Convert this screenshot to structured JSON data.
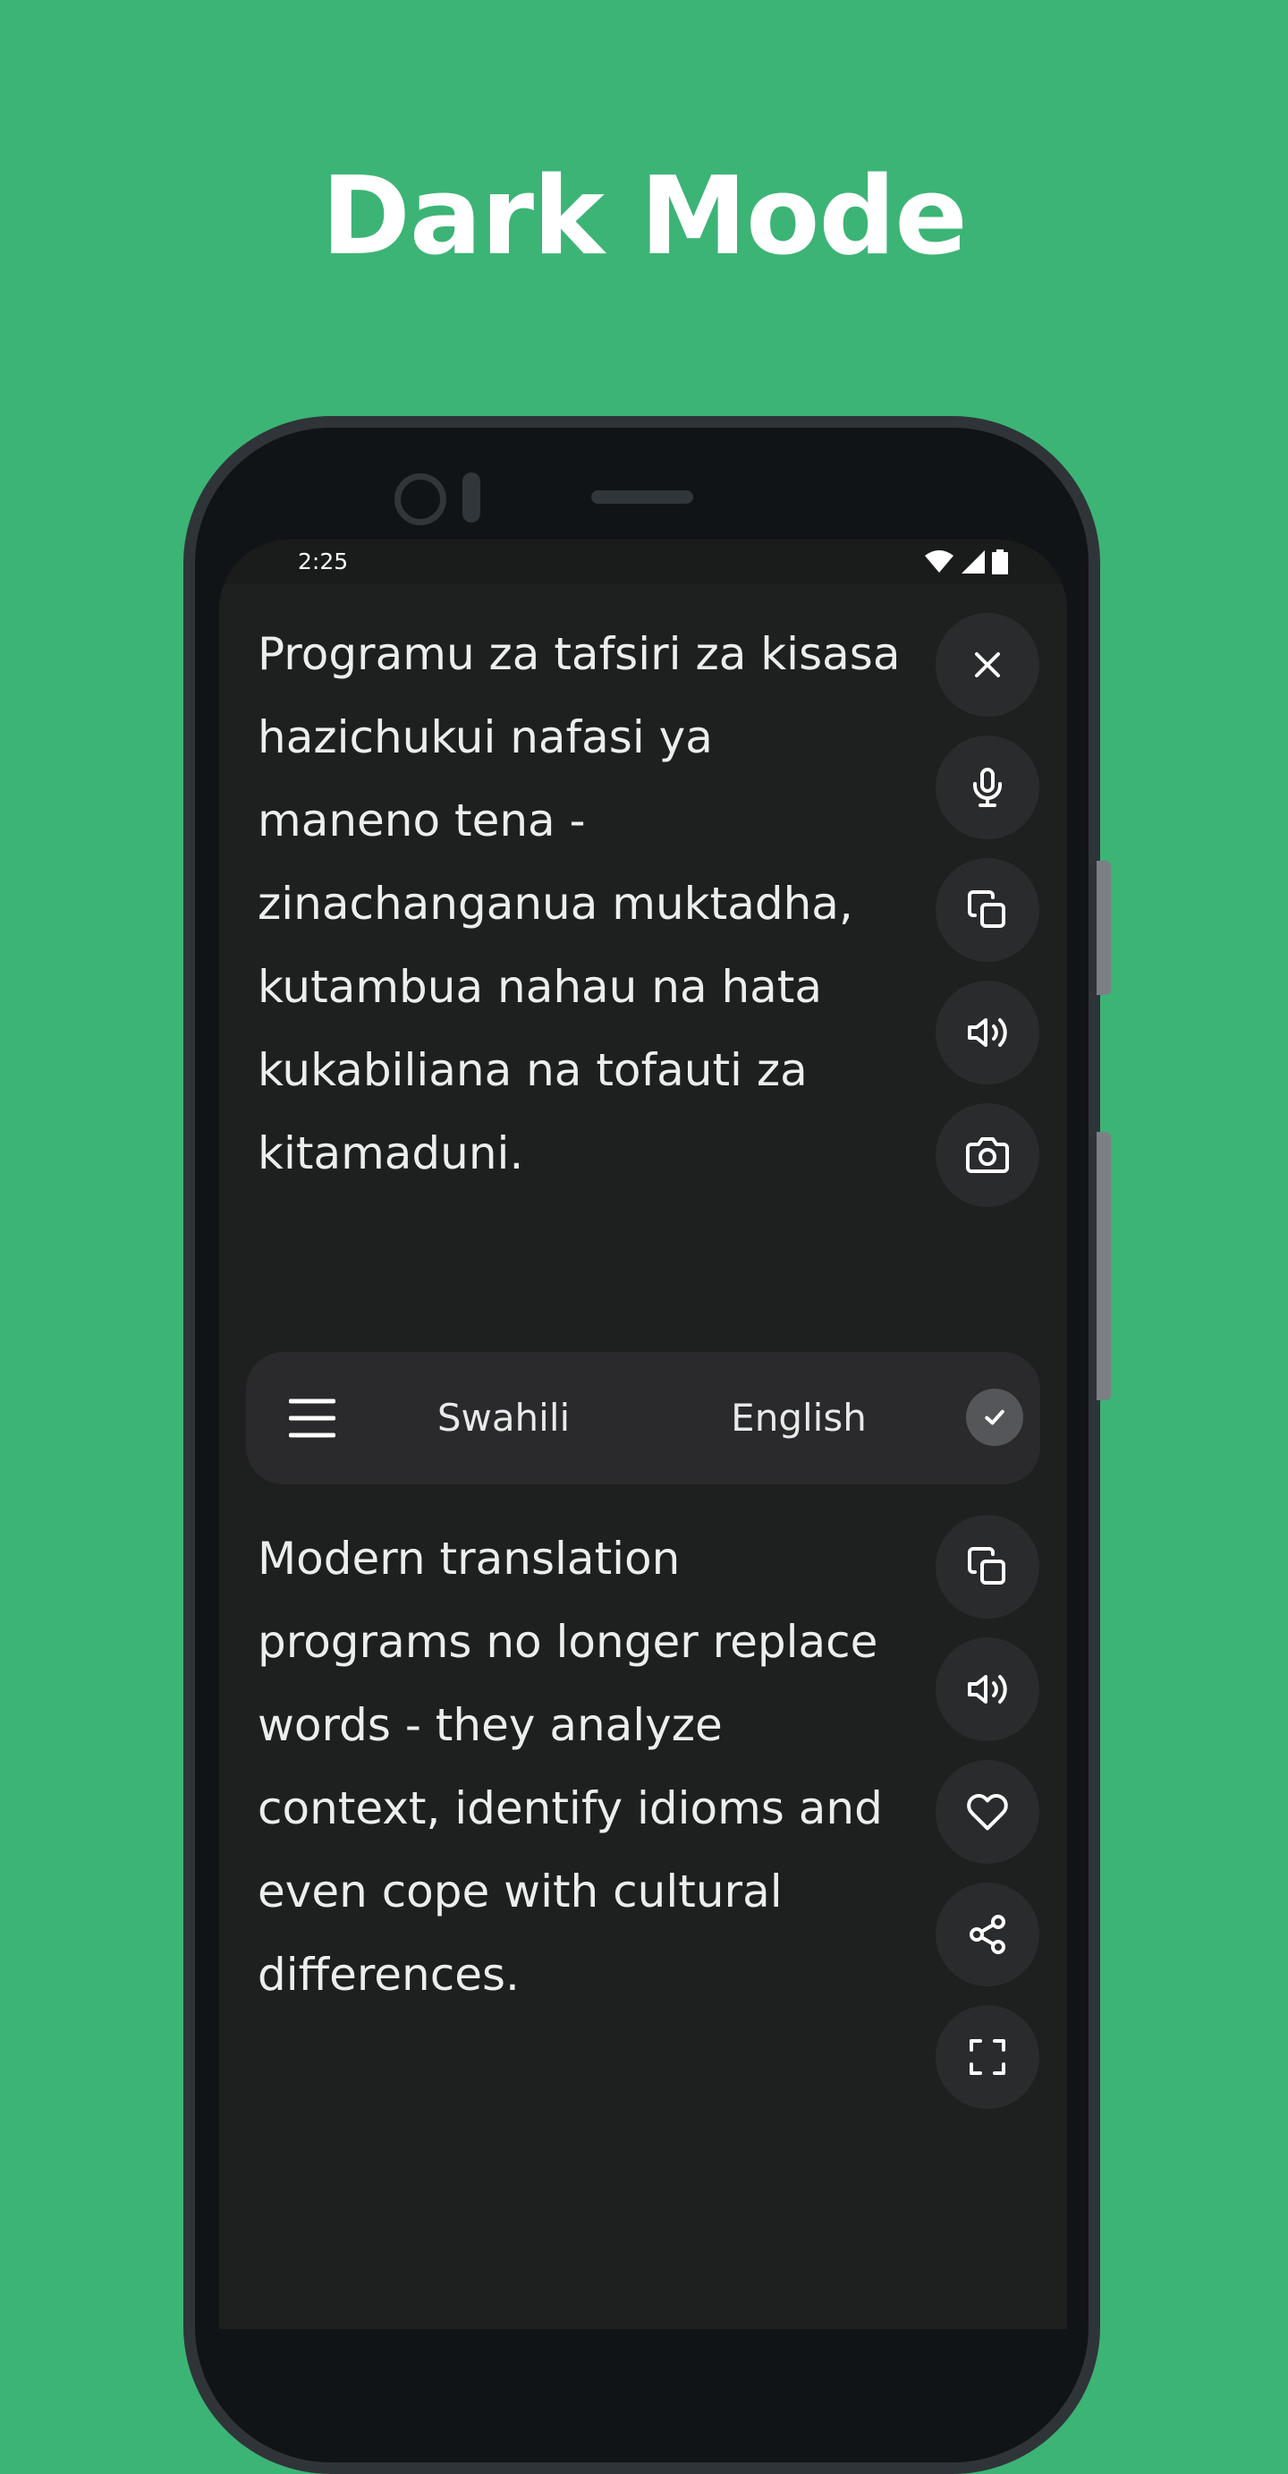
{
  "headline": "Dark Mode",
  "status_bar": {
    "time": "2:25",
    "icons": [
      "wifi-icon",
      "cellular-signal-icon",
      "battery-icon"
    ]
  },
  "source": {
    "text": "Programu za tafsiri za kisasa hazichukui nafasi ya maneno tena - zinachanganua muktadha, kutambua nahau na hata kukabiliana na tofauti za kitamaduni.",
    "actions": [
      "close-icon",
      "microphone-icon",
      "copy-icon",
      "speaker-icon",
      "camera-icon"
    ]
  },
  "language_bar": {
    "menu_icon": "menu-icon",
    "source_language": "Swahili",
    "target_language": "English",
    "confirm_icon": "check-icon"
  },
  "target": {
    "text": "Modern translation programs no longer replace words - they analyze context, identify idioms and even cope with cultural differences.",
    "actions": [
      "copy-icon",
      "speaker-icon",
      "heart-icon",
      "share-icon",
      "fullscreen-icon"
    ]
  },
  "colors": {
    "background": "#3cb475",
    "screen": "#1e1f1f",
    "button": "#2a2b2c",
    "language_bar": "#2a2a2c",
    "text": "#eceeee"
  }
}
